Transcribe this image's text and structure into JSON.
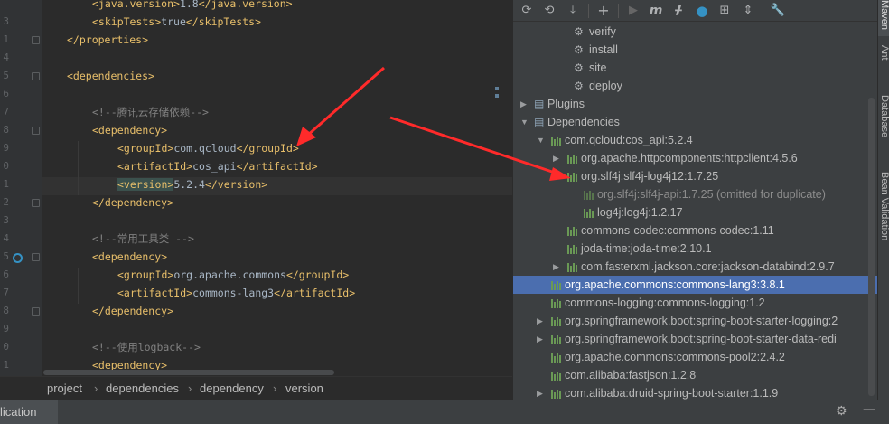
{
  "editor": {
    "lines": [
      {
        "num": "",
        "parts": [
          {
            "t": "<java.version>",
            "c": "tag"
          },
          {
            "t": "1.8",
            "c": "txt"
          },
          {
            "t": "</java.version>",
            "c": "tag"
          }
        ]
      },
      {
        "num": "3",
        "parts": [
          {
            "t": "<skipTests>",
            "c": "tag"
          },
          {
            "t": "true",
            "c": "txt"
          },
          {
            "t": "</skipTests>",
            "c": "tag"
          }
        ]
      },
      {
        "num": "1",
        "parts": [
          {
            "t": "</properties>",
            "c": "tag"
          }
        ]
      },
      {
        "num": "4",
        "parts": []
      },
      {
        "num": "5",
        "parts": [
          {
            "t": "<dependencies>",
            "c": "tag"
          }
        ]
      },
      {
        "num": "6",
        "parts": []
      },
      {
        "num": "7",
        "parts": [
          {
            "t": "<!--腾讯云存储依赖-->",
            "c": "cmt"
          }
        ]
      },
      {
        "num": "8",
        "parts": [
          {
            "t": "<dependency>",
            "c": "tag"
          }
        ]
      },
      {
        "num": "9",
        "parts": [
          {
            "t": "<groupId>",
            "c": "tag"
          },
          {
            "t": "com.qcloud",
            "c": "txt"
          },
          {
            "t": "</groupId>",
            "c": "tag"
          }
        ]
      },
      {
        "num": "0",
        "parts": [
          {
            "t": "<artifactId>",
            "c": "tag"
          },
          {
            "t": "cos_api",
            "c": "txt"
          },
          {
            "t": "</artifactId>",
            "c": "tag"
          }
        ]
      },
      {
        "num": "1",
        "parts": [
          {
            "t": "<version>",
            "c": "tag"
          },
          {
            "t": "5.2.4",
            "c": "txt"
          },
          {
            "t": "</version>",
            "c": "tag"
          }
        ]
      },
      {
        "num": "2",
        "parts": [
          {
            "t": "</dependency>",
            "c": "tag"
          }
        ]
      },
      {
        "num": "3",
        "parts": []
      },
      {
        "num": "4",
        "parts": [
          {
            "t": "<!--常用工具类 -->",
            "c": "cmt"
          }
        ]
      },
      {
        "num": "5",
        "parts": [
          {
            "t": "<dependency>",
            "c": "tag"
          }
        ]
      },
      {
        "num": "6",
        "parts": [
          {
            "t": "<groupId>",
            "c": "tag"
          },
          {
            "t": "org.apache.commons",
            "c": "txt"
          },
          {
            "t": "</groupId>",
            "c": "tag"
          }
        ]
      },
      {
        "num": "7",
        "parts": [
          {
            "t": "<artifactId>",
            "c": "tag"
          },
          {
            "t": "commons-lang3",
            "c": "txt"
          },
          {
            "t": "</artifactId>",
            "c": "tag"
          }
        ]
      },
      {
        "num": "8",
        "parts": [
          {
            "t": "</dependency>",
            "c": "tag"
          }
        ]
      },
      {
        "num": "9",
        "parts": []
      },
      {
        "num": "0",
        "parts": [
          {
            "t": "<!--使用logback-->",
            "c": "cmt"
          }
        ]
      },
      {
        "num": "1",
        "parts": [
          {
            "t": "<dependency>",
            "c": "tag"
          }
        ]
      }
    ]
  },
  "breadcrumb": [
    "project",
    "dependencies",
    "dependency",
    "version"
  ],
  "bottom": {
    "tab_label": "lication"
  },
  "maven": {
    "rows": [
      {
        "label": "verify",
        "type": "goal",
        "indent": 4
      },
      {
        "label": "install",
        "type": "goal",
        "indent": 4
      },
      {
        "label": "site",
        "type": "goal",
        "indent": 4
      },
      {
        "label": "deploy",
        "type": "goal",
        "indent": 4
      },
      {
        "label": "Plugins",
        "type": "folder",
        "indent": 1,
        "arrow": "right"
      },
      {
        "label": "Dependencies",
        "type": "folder",
        "indent": 1,
        "arrow": "down"
      },
      {
        "label": "com.qcloud:cos_api:5.2.4",
        "type": "dep",
        "indent": 2,
        "arrow": "down"
      },
      {
        "label": "org.apache.httpcomponents:httpclient:4.5.6",
        "type": "dep",
        "indent": 3,
        "arrow": "right"
      },
      {
        "label": "org.slf4j:slf4j-log4j12:1.7.25",
        "type": "dep",
        "indent": 3,
        "arrow": "down"
      },
      {
        "label": "org.slf4j:slf4j-api:1.7.25 (omitted for duplicate)",
        "type": "dep",
        "indent": 4,
        "dim": true
      },
      {
        "label": "log4j:log4j:1.2.17",
        "type": "dep",
        "indent": 4
      },
      {
        "label": "commons-codec:commons-codec:1.11",
        "type": "dep",
        "indent": 3
      },
      {
        "label": "joda-time:joda-time:2.10.1",
        "type": "dep",
        "indent": 3
      },
      {
        "label": "com.fasterxml.jackson.core:jackson-databind:2.9.7",
        "type": "dep",
        "indent": 3,
        "arrow": "right"
      },
      {
        "label": "org.apache.commons:commons-lang3:3.8.1",
        "type": "dep",
        "indent": 2,
        "selected": true
      },
      {
        "label": "commons-logging:commons-logging:1.2",
        "type": "dep",
        "indent": 2
      },
      {
        "label": "org.springframework.boot:spring-boot-starter-logging:2",
        "type": "dep",
        "indent": 2,
        "arrow": "right"
      },
      {
        "label": "org.springframework.boot:spring-boot-starter-data-redi",
        "type": "dep",
        "indent": 2,
        "arrow": "right"
      },
      {
        "label": "org.apache.commons:commons-pool2:2.4.2",
        "type": "dep",
        "indent": 2
      },
      {
        "label": "com.alibaba:fastjson:1.2.8",
        "type": "dep",
        "indent": 2
      },
      {
        "label": "com.alibaba:druid-spring-boot-starter:1.1.9",
        "type": "dep",
        "indent": 2,
        "arrow": "right"
      }
    ]
  },
  "side_tabs": [
    "Maven",
    "Ant",
    "Database",
    "Bean Validation"
  ],
  "colors": {
    "tag": "#e8bf6a",
    "text": "#a9b7c6",
    "comment": "#808080",
    "selection": "#4b6eaf",
    "dep_icon": "#6a9955",
    "arrow": "#ff2a2a"
  }
}
